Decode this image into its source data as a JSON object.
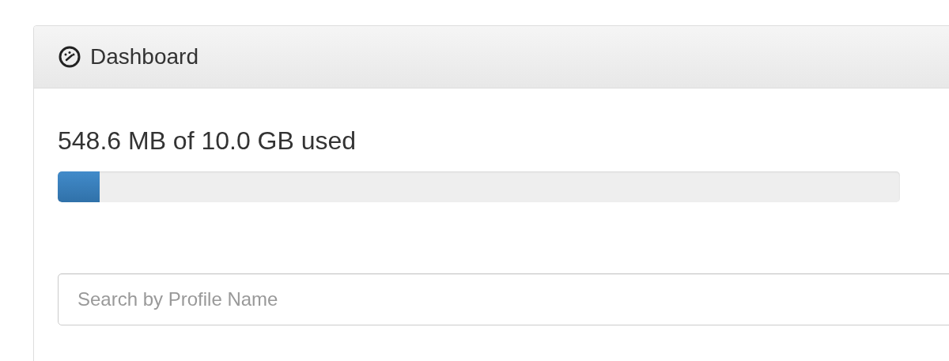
{
  "panel": {
    "title": "Dashboard"
  },
  "storage": {
    "label": "548.6 MB of 10.0 GB used",
    "level": 0.05
  },
  "search": {
    "placeholder": "Search by Profile Name"
  }
}
